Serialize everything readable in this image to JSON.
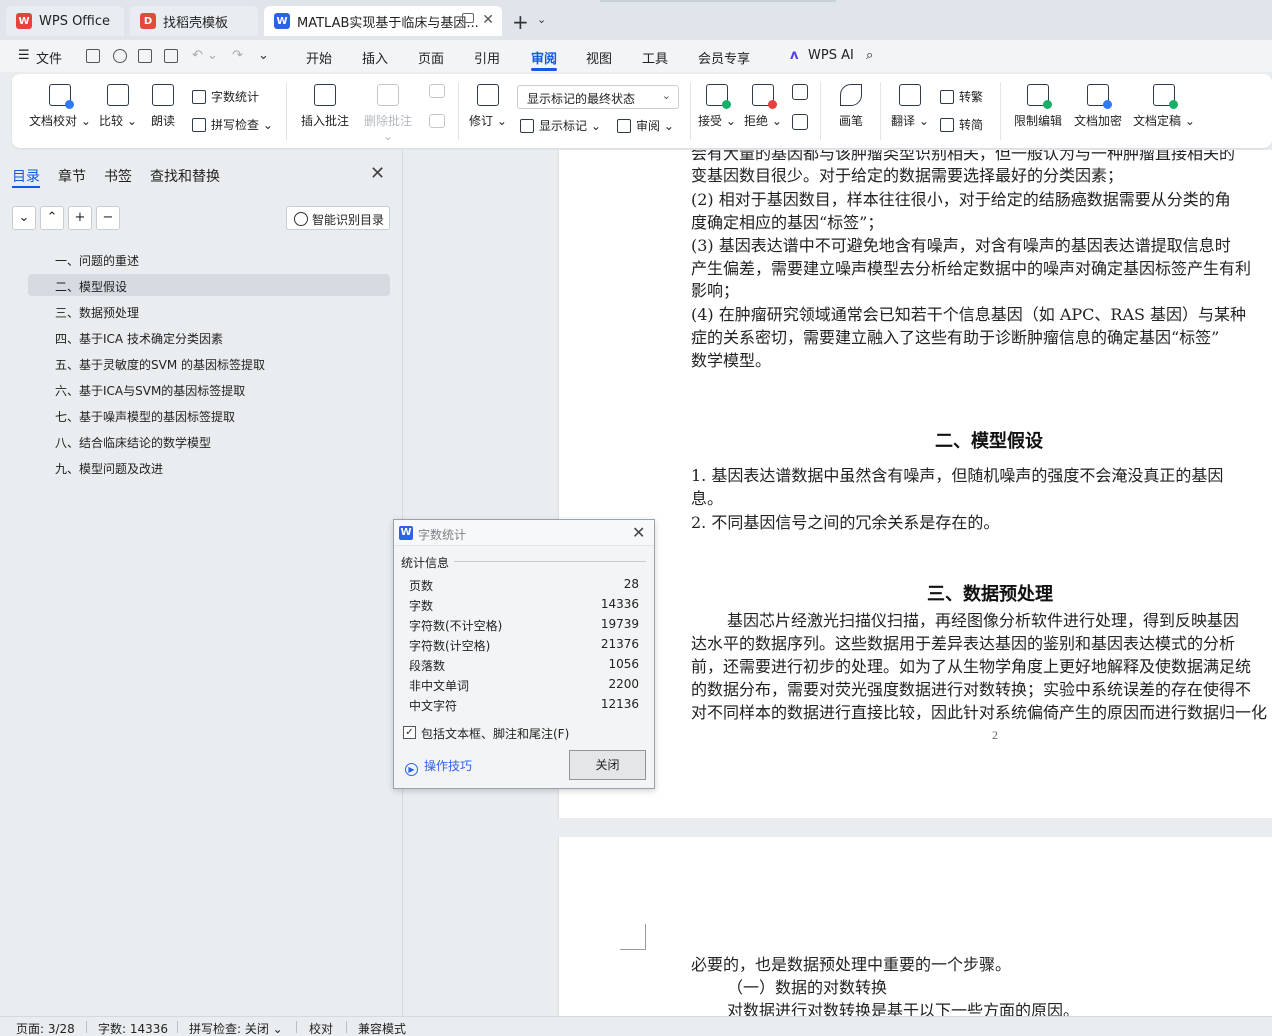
{
  "tabs": [
    {
      "label": "WPS Office"
    },
    {
      "label": "找稻壳模板"
    },
    {
      "label": "MATLAB实现基于临床与基因..."
    }
  ],
  "menu": {
    "file": "文件",
    "items": [
      "开始",
      "插入",
      "页面",
      "引用",
      "审阅",
      "视图",
      "工具",
      "会员专享"
    ],
    "active": "审阅",
    "ai": "WPS AI"
  },
  "ribbon": {
    "doc_check": "文档校对",
    "compare": "比较",
    "read_aloud": "朗读",
    "word_count": "字数统计",
    "spell_check": "拼写检查",
    "insert_comment": "插入批注",
    "delete_comment": "删除批注",
    "revise": "修订",
    "markup_dropdown": "显示标记的最终状态",
    "show_markup": "显示标记",
    "review": "审阅",
    "accept": "接受",
    "reject": "拒绝",
    "ink": "画笔",
    "translate": "翻译",
    "trad_to_simp": "转繁",
    "simp_to_trad": "转简",
    "restrict_edit": "限制编辑",
    "encrypt": "文档加密",
    "finalize": "文档定稿"
  },
  "nav_panel": {
    "tabs": [
      "目录",
      "章节",
      "书签",
      "查找和替换"
    ],
    "active_tab": "目录",
    "smart_button": "智能识别目录",
    "items": [
      "一、问题的重述",
      "二、模型假设",
      "三、数据预处理",
      "四、基于ICA 技术确定分类因素",
      "五、基于灵敏度的SVM 的基因标签提取",
      "六、基于ICA与SVM的基因标签提取",
      "七、基于噪声模型的基因标签提取",
      "八、结合临床结论的数学模型",
      "九、模型问题及改进"
    ],
    "selected_index": 1
  },
  "document": {
    "page1_lines": [
      "会有大量的基因都与该肿瘤类型识别相关，但一般认为与一种肿瘤直接相关的",
      "变基因数目很少。对于给定的数据需要选择最好的分类因素；",
      "(2)   相对于基因数目，样本往往很小，对于给定的结肠癌数据需要从分类的角",
      "度确定相应的基因“标签”；",
      "(3)   基因表达谱中不可避免地含有噪声，对含有噪声的基因表达谱提取信息时",
      "产生偏差，需要建立噪声模型去分析给定数据中的噪声对确定基因标签产生有利",
      "影响；",
      "(4)   在肿瘤研究领域通常会已知若干个信息基因（如 APC、RAS 基因）与某种",
      "症的关系密切，需要建立融入了这些有助于诊断肿瘤信息的确定基因“标签”",
      "数学模型。"
    ],
    "heading2": "二、模型假设",
    "assumptions": [
      "1. 基因表达谱数据中虽然含有噪声，但随机噪声的强度不会淹没真正的基因",
      "息。",
      "2. 不同基因信号之间的冗余关系是存在的。"
    ],
    "heading3": "三、数据预处理",
    "para3": [
      "基因芯片经激光扫描仪扫描，再经图像分析软件进行处理，得到反映基因",
      "达水平的数据序列。这些数据用于差异表达基因的鉴别和基因表达模式的分析",
      "前，还需要进行初步的处理。如为了从生物学角度上更好地解释及使数据满足统",
      "的数据分布，需要对荧光强度数据进行对数转换；实验中系统误差的存在使得不",
      "对不同样本的数据进行直接比较，因此针对系统偏倚产生的原因而进行数据归一化"
    ],
    "page_number": "2",
    "heading_marker": "H",
    "page2_lines": [
      "必要的，也是数据预处理中重要的一个步骤。",
      "（一）数据的对数转换",
      "对数据进行对数转换是基于以下一些方面的原因。"
    ]
  },
  "dialog": {
    "title": "字数统计",
    "section": "统计信息",
    "stats": [
      {
        "label": "页数",
        "value": "28"
      },
      {
        "label": "字数",
        "value": "14336"
      },
      {
        "label": "字符数(不计空格)",
        "value": "19739"
      },
      {
        "label": "字符数(计空格)",
        "value": "21376"
      },
      {
        "label": "段落数",
        "value": "1056"
      },
      {
        "label": "非中文单词",
        "value": "2200"
      },
      {
        "label": "中文字符",
        "value": "12136"
      }
    ],
    "checkbox_label": "包括文本框、脚注和尾注(F)",
    "checkbox_checked": true,
    "tips_link": "操作技巧",
    "close_button": "关闭"
  },
  "statusbar": {
    "page": "页面: 3/28",
    "words": "字数: 14336",
    "spell": "拼写检查: 关闭",
    "proof": "校对",
    "compat": "兼容模式"
  },
  "colors": {
    "accent": "#1656e8",
    "wps_red": "#e8403a",
    "docer_red": "#e24b3b",
    "doc_blue": "#2c63e6"
  }
}
